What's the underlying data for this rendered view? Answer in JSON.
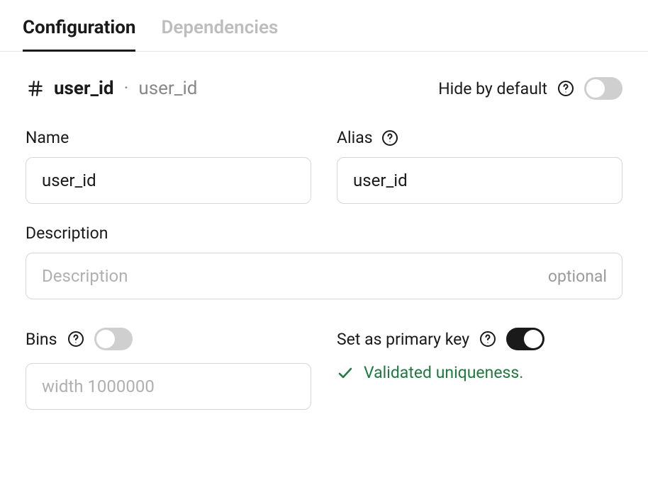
{
  "tabs": {
    "configuration": "Configuration",
    "dependencies": "Dependencies"
  },
  "header": {
    "primary": "user_id",
    "secondary": "user_id",
    "hide_default_label": "Hide by default"
  },
  "fields": {
    "name": {
      "label": "Name",
      "value": "user_id"
    },
    "alias": {
      "label": "Alias",
      "value": "user_id"
    },
    "description": {
      "label": "Description",
      "placeholder": "Description",
      "suffix": "optional",
      "value": ""
    },
    "bins": {
      "label": "Bins",
      "placeholder": "width 1000000",
      "value": "",
      "enabled": false
    },
    "primary_key": {
      "label": "Set as primary key",
      "enabled": true,
      "validation_message": "Validated uniqueness."
    }
  },
  "toggles": {
    "hide_default": false,
    "bins": false,
    "primary_key": true
  }
}
